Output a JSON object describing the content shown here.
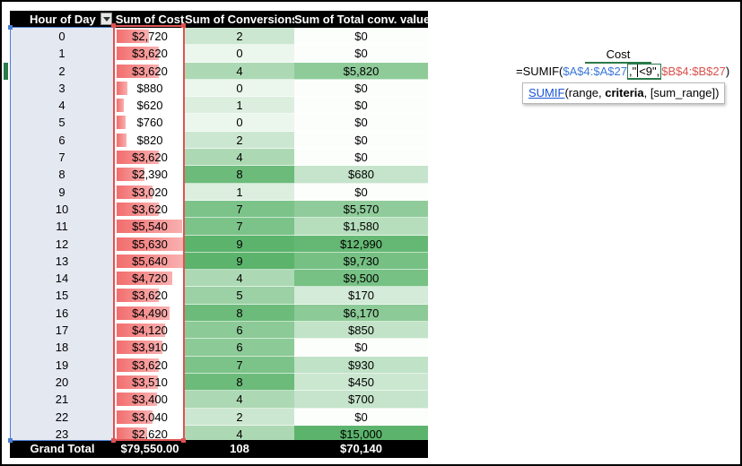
{
  "headers": {
    "hour": "Hour of Day",
    "cost": "Sum of Cost",
    "conversions": "Sum of Conversions",
    "value": "Sum of Total conv. value"
  },
  "rows": [
    {
      "hour": "0",
      "cost": "$2,720",
      "cost_num": 2720,
      "conv": "2",
      "conv_num": 2,
      "value": "$0",
      "value_num": 0
    },
    {
      "hour": "1",
      "cost": "$3,620",
      "cost_num": 3620,
      "conv": "0",
      "conv_num": 0,
      "value": "$0",
      "value_num": 0
    },
    {
      "hour": "2",
      "cost": "$3,620",
      "cost_num": 3620,
      "conv": "4",
      "conv_num": 4,
      "value": "$5,820",
      "value_num": 5820
    },
    {
      "hour": "3",
      "cost": "$880",
      "cost_num": 880,
      "conv": "0",
      "conv_num": 0,
      "value": "$0",
      "value_num": 0
    },
    {
      "hour": "4",
      "cost": "$620",
      "cost_num": 620,
      "conv": "1",
      "conv_num": 1,
      "value": "$0",
      "value_num": 0
    },
    {
      "hour": "5",
      "cost": "$760",
      "cost_num": 760,
      "conv": "0",
      "conv_num": 0,
      "value": "$0",
      "value_num": 0
    },
    {
      "hour": "6",
      "cost": "$820",
      "cost_num": 820,
      "conv": "2",
      "conv_num": 2,
      "value": "$0",
      "value_num": 0
    },
    {
      "hour": "7",
      "cost": "$3,620",
      "cost_num": 3620,
      "conv": "4",
      "conv_num": 4,
      "value": "$0",
      "value_num": 0
    },
    {
      "hour": "8",
      "cost": "$2,390",
      "cost_num": 2390,
      "conv": "8",
      "conv_num": 8,
      "value": "$680",
      "value_num": 680
    },
    {
      "hour": "9",
      "cost": "$3,020",
      "cost_num": 3020,
      "conv": "1",
      "conv_num": 1,
      "value": "$0",
      "value_num": 0
    },
    {
      "hour": "10",
      "cost": "$3,620",
      "cost_num": 3620,
      "conv": "7",
      "conv_num": 7,
      "value": "$5,570",
      "value_num": 5570
    },
    {
      "hour": "11",
      "cost": "$5,540",
      "cost_num": 5540,
      "conv": "7",
      "conv_num": 7,
      "value": "$1,580",
      "value_num": 1580
    },
    {
      "hour": "12",
      "cost": "$5,630",
      "cost_num": 5630,
      "conv": "9",
      "conv_num": 9,
      "value": "$12,990",
      "value_num": 12990
    },
    {
      "hour": "13",
      "cost": "$5,640",
      "cost_num": 5640,
      "conv": "9",
      "conv_num": 9,
      "value": "$9,730",
      "value_num": 9730
    },
    {
      "hour": "14",
      "cost": "$4,720",
      "cost_num": 4720,
      "conv": "4",
      "conv_num": 4,
      "value": "$9,500",
      "value_num": 9500
    },
    {
      "hour": "15",
      "cost": "$3,620",
      "cost_num": 3620,
      "conv": "5",
      "conv_num": 5,
      "value": "$170",
      "value_num": 170
    },
    {
      "hour": "16",
      "cost": "$4,490",
      "cost_num": 4490,
      "conv": "8",
      "conv_num": 8,
      "value": "$6,170",
      "value_num": 6170
    },
    {
      "hour": "17",
      "cost": "$4,120",
      "cost_num": 4120,
      "conv": "6",
      "conv_num": 6,
      "value": "$850",
      "value_num": 850
    },
    {
      "hour": "18",
      "cost": "$3,910",
      "cost_num": 3910,
      "conv": "6",
      "conv_num": 6,
      "value": "$0",
      "value_num": 0
    },
    {
      "hour": "19",
      "cost": "$3,620",
      "cost_num": 3620,
      "conv": "7",
      "conv_num": 7,
      "value": "$930",
      "value_num": 930
    },
    {
      "hour": "20",
      "cost": "$3,510",
      "cost_num": 3510,
      "conv": "8",
      "conv_num": 8,
      "value": "$450",
      "value_num": 450
    },
    {
      "hour": "21",
      "cost": "$3,400",
      "cost_num": 3400,
      "conv": "4",
      "conv_num": 4,
      "value": "$700",
      "value_num": 700
    },
    {
      "hour": "22",
      "cost": "$3,040",
      "cost_num": 3040,
      "conv": "2",
      "conv_num": 2,
      "value": "$0",
      "value_num": 0
    },
    {
      "hour": "23",
      "cost": "$2,620",
      "cost_num": 2620,
      "conv": "4",
      "conv_num": 4,
      "value": "$15,000",
      "value_num": 15000
    }
  ],
  "totals": {
    "label": "Grand Total",
    "cost": "$79,550.00",
    "conversions": "108",
    "value": "$70,140"
  },
  "colors": {
    "bar": "#f26d6d",
    "scale_low": "#ffffff",
    "scale_high": "#5cb46c",
    "ref_range": "#3b78d8",
    "sum_range": "#d9534f"
  },
  "formula": {
    "cell_label": "Cost",
    "prefix": "=SUMIF(",
    "range_ref": "$A$4:$A$27",
    "criteria_open": ",\"",
    "criteria_op": "<",
    "criteria_val": "9",
    "criteria_close": "\",",
    "sum_range_ref": "$B$4:$B$27",
    "suffix": ")"
  },
  "tooltip": {
    "function": "SUMIF",
    "open": "(range, ",
    "bold_arg": "criteria",
    "rest": ", [sum_range])"
  }
}
